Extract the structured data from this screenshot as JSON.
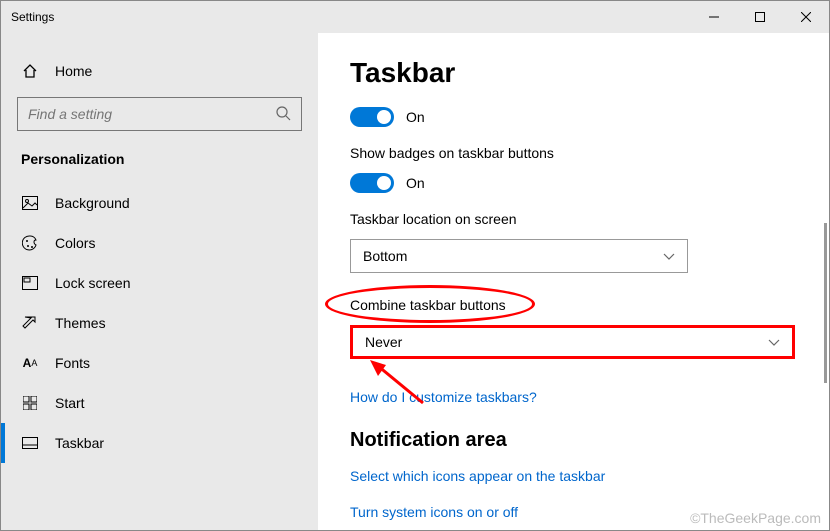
{
  "window": {
    "title": "Settings"
  },
  "sidebar": {
    "home": "Home",
    "search_placeholder": "Find a setting",
    "category": "Personalization",
    "items": [
      {
        "label": "Background"
      },
      {
        "label": "Colors"
      },
      {
        "label": "Lock screen"
      },
      {
        "label": "Themes"
      },
      {
        "label": "Fonts"
      },
      {
        "label": "Start"
      },
      {
        "label": "Taskbar"
      }
    ]
  },
  "main": {
    "heading": "Taskbar",
    "toggle1_state": "On",
    "badges_label": "Show badges on taskbar buttons",
    "toggle2_state": "On",
    "location_label": "Taskbar location on screen",
    "location_value": "Bottom",
    "combine_label": "Combine taskbar buttons",
    "combine_value": "Never",
    "customize_link": "How do I customize taskbars?",
    "notification_header": "Notification area",
    "select_icons_link": "Select which icons appear on the taskbar",
    "system_icons_link": "Turn system icons on or off"
  },
  "watermark": "©TheGeekPage.com"
}
